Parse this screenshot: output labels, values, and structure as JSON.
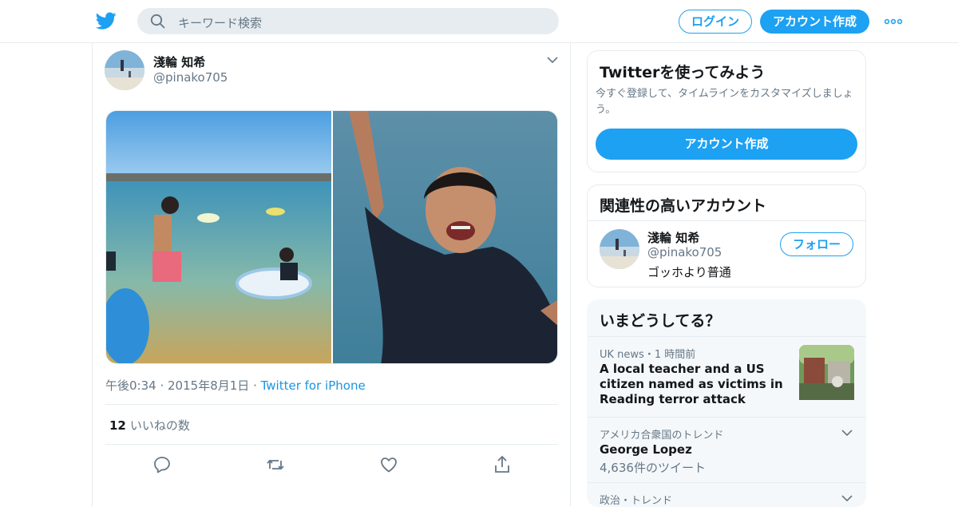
{
  "header": {
    "search_placeholder": "キーワード検索",
    "login_label": "ログイン",
    "signup_label": "アカウント作成"
  },
  "tweet": {
    "author_name": "淺輪 知希",
    "author_handle": "@pinako705",
    "time": "午後0:34",
    "date": "2015年8月1日",
    "source": "Twitter for iPhone",
    "likes_count": "12",
    "likes_label": "いいねの数"
  },
  "signup_card": {
    "title": "Twitterを使ってみよう",
    "description": "今すぐ登録して、タイムラインをカスタマイズしましょう。",
    "button_label": "アカウント作成"
  },
  "related_card": {
    "title": "関連性の高いアカウント",
    "account": {
      "name": "淺輪 知希",
      "handle": "@pinako705",
      "bio": "ゴッホより普通",
      "follow_label": "フォロー"
    }
  },
  "trends_card": {
    "title": "いまどうしてる？",
    "items": [
      {
        "context": "UK news・1 時間前",
        "title": "A local teacher and a US citizen named as victims in Reading terror attack",
        "count": ""
      },
      {
        "context": "アメリカ合衆国のトレンド",
        "title": "George Lopez",
        "count": "4,636件のツイート"
      },
      {
        "context": "政治・トレンド",
        "title": "",
        "count": ""
      }
    ]
  },
  "colors": {
    "brand": "#1da1f2",
    "text": "#14171a",
    "secondary": "#657786",
    "border": "#e6ecf0",
    "panel_bg": "#f5f8fa"
  }
}
